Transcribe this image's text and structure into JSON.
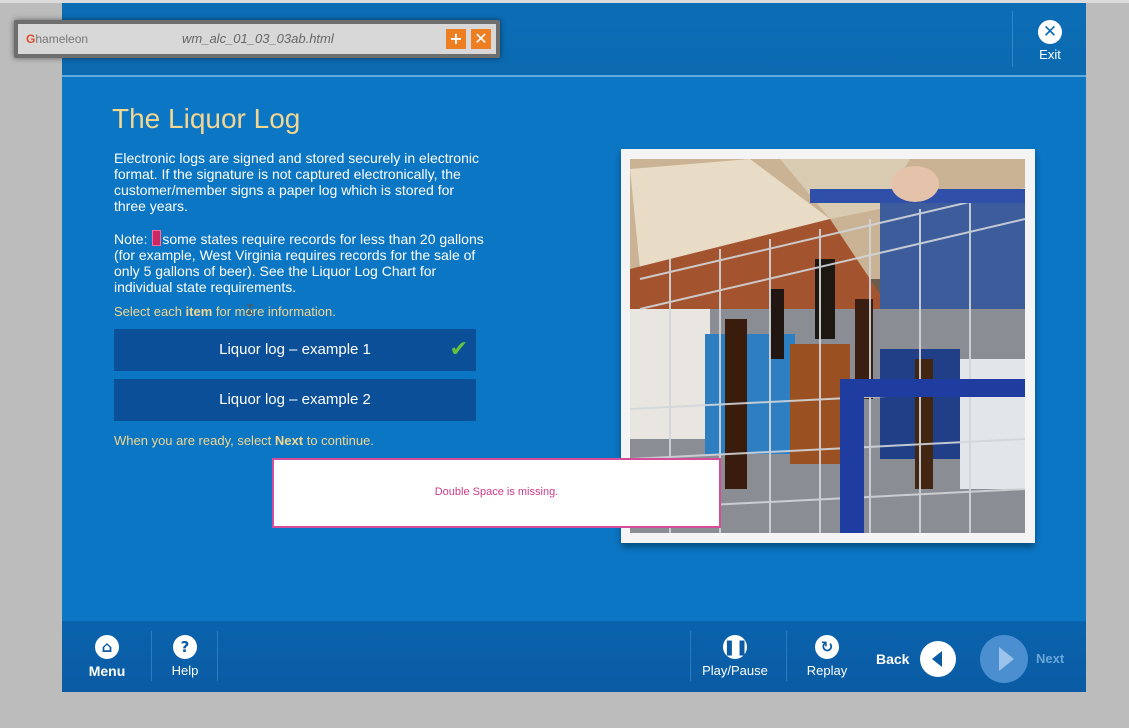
{
  "chameleon_bar": {
    "logo": "Chameleon",
    "filename": "wm_alc_01_03_03ab.html",
    "add_icon": "plus-icon",
    "close_icon": "close-icon"
  },
  "header": {
    "exit_label": "Exit",
    "exit_icon": "close-circle-icon"
  },
  "content": {
    "title": "The Liquor Log",
    "paragraph1": "Electronic logs are signed and stored securely in electronic format.  If the signature is not captured electronically, the customer/member signs a paper log which is stored for three years.",
    "paragraph2_a": "Note: ",
    "paragraph2_b": "some states require records for less than 20 gallons (for example, West Virginia requires records for the sale of only 5 gallons of beer).  See the Liquor Log Chart for individual state requirements.",
    "select_prefix": "Select each ",
    "select_bold": "item",
    "select_suffix": " for more information.",
    "option1": "Liquor log – example 1",
    "option1_checked": true,
    "option2": "Liquor log – example 2",
    "ready_prefix": "When you are ready, select ",
    "ready_bold": "Next",
    "ready_suffix": " to continue."
  },
  "comment": {
    "text": "Double Space is missing."
  },
  "footer": {
    "menu": "Menu",
    "help": "Help",
    "play_pause": "Play/Pause",
    "replay": "Replay",
    "back": "Back",
    "next": "Next"
  },
  "colors": {
    "background": "#0b76c3",
    "title": "#f3d690",
    "option_bg": "#0a4f98",
    "check": "#66c23b",
    "comment_border": "#d44c9a"
  }
}
